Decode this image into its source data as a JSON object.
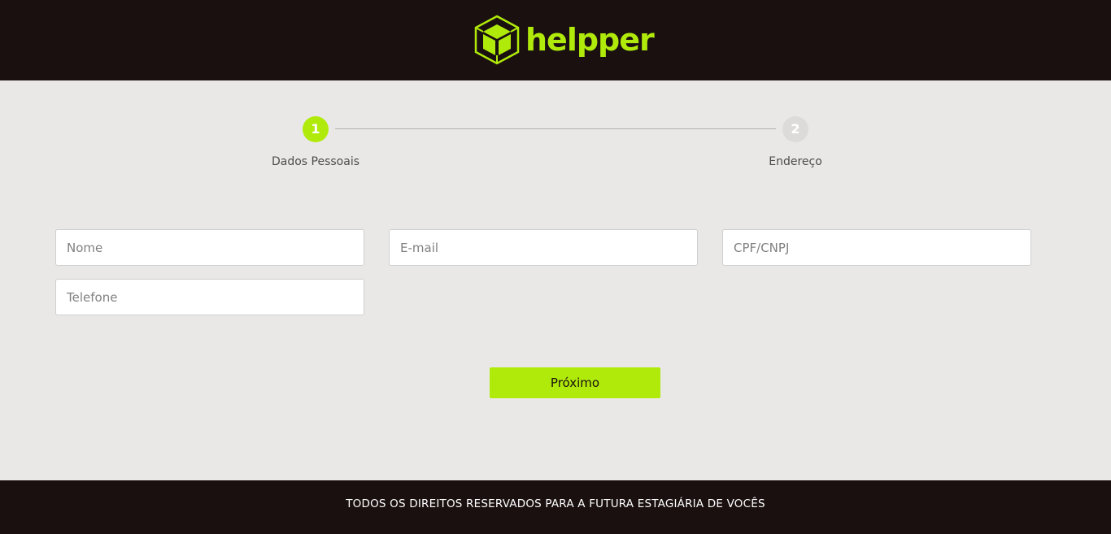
{
  "header": {
    "brand": "helpper",
    "logo_icon": "cube-icon",
    "accent_color": "#b0ea0a",
    "background_color": "#1a1010"
  },
  "stepper": {
    "steps": [
      {
        "number": "1",
        "label": "Dados Pessoais",
        "state": "active"
      },
      {
        "number": "2",
        "label": "Endereço",
        "state": "inactive"
      }
    ]
  },
  "form": {
    "name_placeholder": "Nome",
    "email_placeholder": "E-mail",
    "document_placeholder": "CPF/CNPJ",
    "phone_placeholder": "Telefone",
    "next_label": "Próximo"
  },
  "footer": {
    "text": "TODOS OS DIREITOS RESERVADOS PARA A FUTURA ESTAGIÁRIA DE VOCÊS"
  }
}
